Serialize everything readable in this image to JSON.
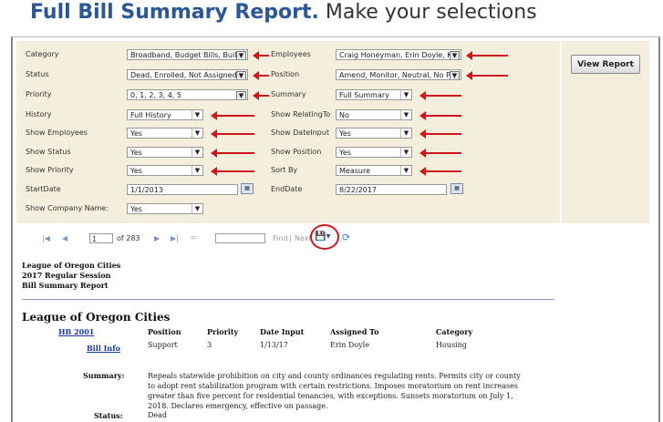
{
  "title": {
    "bold": "Full Bill Summary Report.",
    "rest": " Make your selections"
  },
  "params": {
    "category": {
      "label": "Category",
      "value": "Broadband, Budget Bills, Buildi"
    },
    "status": {
      "label": "Status",
      "value": "Dead, Enrolled, Not Assigned, V"
    },
    "priority": {
      "label": "Priority",
      "value": "0, 1, 2, 3, 4, 5"
    },
    "history": {
      "label": "History",
      "value": "Full History"
    },
    "show_employees": {
      "label": "Show Employees",
      "value": "Yes"
    },
    "show_status": {
      "label": "Show Status",
      "value": "Yes"
    },
    "show_priority": {
      "label": "Show Priority",
      "value": "Yes"
    },
    "start_date": {
      "label": "StartDate",
      "value": "1/1/2013"
    },
    "show_company": {
      "label": "Show Company Name:",
      "value": "Yes"
    },
    "employees": {
      "label": "Employees",
      "value": "Craig Honeyman, Erin Doyle, Ki"
    },
    "position": {
      "label": "Position",
      "value": "Amend, Monitor, Neutral, No Pc"
    },
    "summary": {
      "label": "Summary",
      "value": "Full Summary"
    },
    "show_relating": {
      "label": "Show RelatingTo",
      "value": "No"
    },
    "show_date_input": {
      "label": "Show DateInput",
      "value": "Yes"
    },
    "show_position": {
      "label": "Show Position",
      "value": "Yes"
    },
    "sort_by": {
      "label": "Sort By",
      "value": "Measure"
    },
    "end_date": {
      "label": "EndDate",
      "value": "8/22/2017"
    }
  },
  "view_report_label": "View Report",
  "toolbar": {
    "first": "|◀",
    "prev": "◀",
    "page": "1",
    "of": "of 283",
    "next": "▶",
    "last": "▶|",
    "back": "⇦",
    "find": "Find",
    "sep": "|",
    "next_label": "Next",
    "export": "💾▾",
    "refresh": "⟳"
  },
  "report_header": {
    "line1": "League of Oregon Cities",
    "line2": "2017 Regular Session",
    "line3": "Bill Summary Report"
  },
  "org": "League of Oregon Cities",
  "columns": {
    "position": "Position",
    "priority": "Priority",
    "date": "Date Input",
    "assigned": "Assigned To",
    "category": "Category"
  },
  "bill": {
    "id": "HB 2001",
    "info": "Bill Info",
    "position": "Support",
    "priority": "3",
    "date": "1/13/17",
    "assigned": "Erin Doyle",
    "category": "Housing",
    "summary_label": "Summary:",
    "summary": "Repeals statewide prohibition on city and county ordinances regulating rents. Permits city or county to adopt rent stabilization program with certain restrictions. Imposes moratorium on rent increases greater than five percent for residential tenancies, with exceptions. Sunsets moratorium on July 1, 2018. Declares emergency, effective on passage.",
    "status_label": "Status:",
    "status": "Dead"
  },
  "colors": {
    "accent": "#2b5797",
    "panel": "#f3efdc",
    "annotation": "#d0161c"
  }
}
